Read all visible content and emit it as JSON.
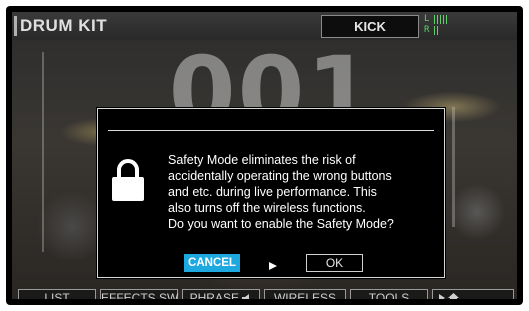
{
  "header": {
    "title": "DRUM KIT",
    "instrument": "KICK",
    "meter": {
      "left_label": "L",
      "right_label": "R"
    }
  },
  "background": {
    "kit_number": "001"
  },
  "dialog": {
    "message_lines": [
      "Safety Mode eliminates the risk of",
      "accidentally operating the wrong buttons",
      "and etc. during live performance. This",
      "also turns off the wireless functions.",
      "Do you want to enable the Safety Mode?"
    ],
    "cancel_label": "CANCEL",
    "ok_label": "OK",
    "lock_icon": "lock-icon",
    "arrow_icon": "arrow-right-icon"
  },
  "function_bar": {
    "list_label": "LIST",
    "effects_label": "EFFECTS SW",
    "phrase_label": "PHRASE",
    "wireless_label": "WIRELESS",
    "tools_label": "TOOLS",
    "home_icon": "home-icon"
  },
  "colors": {
    "accent": "#1ea8e0",
    "meter": "#5fd06a",
    "page_indicator": "#3aa648"
  }
}
